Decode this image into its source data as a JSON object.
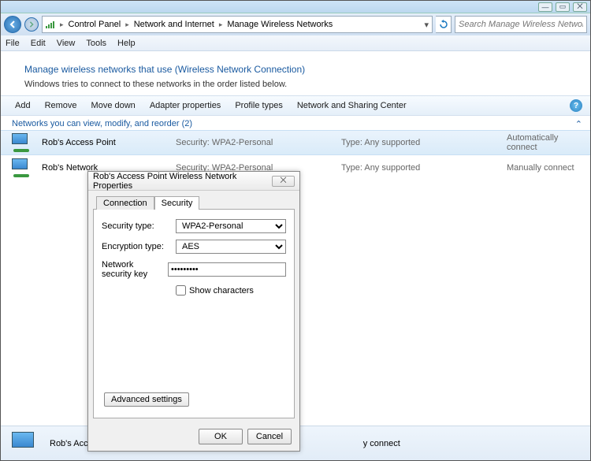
{
  "window_controls": {
    "min": "—",
    "max": "▭",
    "close": "⨉"
  },
  "breadcrumb": [
    "Control Panel",
    "Network and Internet",
    "Manage Wireless Networks"
  ],
  "search_placeholder": "Search Manage Wireless Networks",
  "menubar": [
    "File",
    "Edit",
    "View",
    "Tools",
    "Help"
  ],
  "page_title": "Manage wireless networks that use (Wireless Network Connection)",
  "page_subtitle": "Windows tries to connect to these networks in the order listed below.",
  "toolbar": [
    "Add",
    "Remove",
    "Move down",
    "Adapter properties",
    "Profile types",
    "Network and Sharing Center"
  ],
  "group_header": "Networks you can view, modify, and reorder (2)",
  "networks": [
    {
      "name": "Rob's Access Point",
      "security": "Security: WPA2-Personal",
      "type": "Type: Any supported",
      "connect": "Automatically connect"
    },
    {
      "name": "Rob's Network",
      "security": "Security: WPA2-Personal",
      "type": "Type: Any supported",
      "connect": "Manually connect"
    }
  ],
  "dialog": {
    "title": "Rob's Access Point Wireless Network Properties",
    "tabs": [
      "Connection",
      "Security"
    ],
    "active_tab": 1,
    "fields": {
      "sec_type_label": "Security type:",
      "sec_type_value": "WPA2-Personal",
      "enc_type_label": "Encryption type:",
      "enc_type_value": "AES",
      "key_label": "Network security key",
      "key_value": "•••••••••",
      "show_chars": "Show characters"
    },
    "advanced": "Advanced settings",
    "ok": "OK",
    "cancel": "Cancel"
  },
  "status_name": "Rob's Access",
  "status_connect": "y connect"
}
